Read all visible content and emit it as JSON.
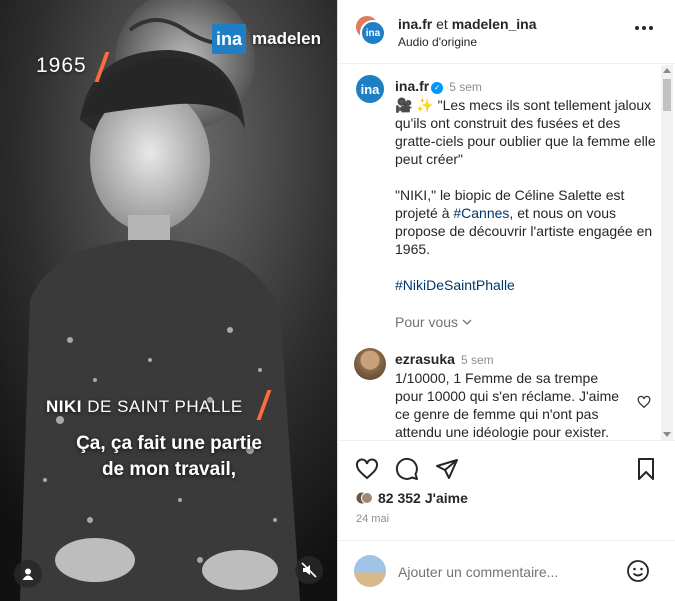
{
  "video": {
    "year": "1965",
    "brand_short": "ina",
    "brand_partner": "madelen",
    "name_first": "NIKI",
    "name_last": "DE SAINT PHALLE",
    "subtitle_line1": "Ça, ça fait une partie",
    "subtitle_line2": "de mon travail,"
  },
  "header": {
    "account1": "ina.fr",
    "joiner": "et",
    "account2": "madelen_ina",
    "audio": "Audio d'origine",
    "avatar_text": "ina"
  },
  "caption": {
    "username": "ina.fr",
    "time": "5 sem",
    "emojis": "🎥 ✨",
    "quote": "\"Les mecs ils sont tellement jaloux qu'ils ont construit des fusées et des gratte-ciels pour oublier que la femme elle peut créer\"",
    "para2_before": "\"NIKI,\" le biopic de Céline Salette est projeté à ",
    "para2_tag": "#Cannes",
    "para2_after": ", et nous on vous propose de découvrir l'artiste engagée en 1965.",
    "hashtag": "#NikiDeSaintPhalle",
    "more": "Pour vous"
  },
  "comment": {
    "username": "ezrasuka",
    "time": "5 sem",
    "text": "1/10000, 1 Femme de sa trempe pour 10000 qui s'en réclame. J'aime ce genre de femme qui n'ont pas attendu une idéologie pour exister."
  },
  "stats": {
    "likes": "82 352",
    "likes_label": "J'aime",
    "date": "24 mai"
  },
  "add_comment": {
    "placeholder": "Ajouter un commentaire..."
  },
  "colors": {
    "ina_blue": "#1f7fc4",
    "accent_orange": "#ff6b3d",
    "link_blue": "#00376b",
    "verified_blue": "#0095f6"
  }
}
